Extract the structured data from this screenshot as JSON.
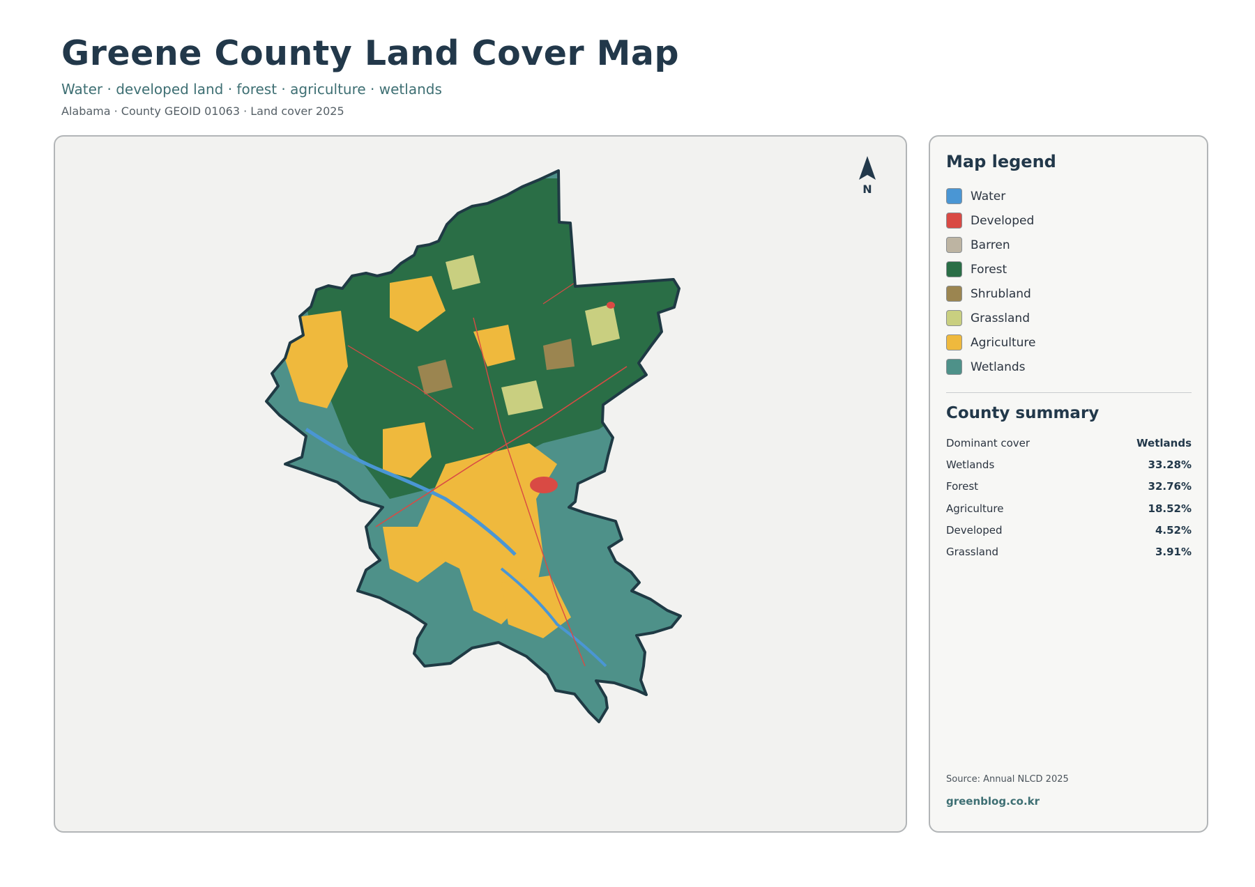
{
  "header": {
    "title": "Greene County Land Cover Map",
    "subtitle": "Water · developed land · forest · agriculture · wetlands",
    "meta": "Alabama · County GEOID 01063 · Land cover 2025"
  },
  "compass": {
    "label": "N"
  },
  "legend": {
    "title": "Map legend",
    "items": [
      {
        "label": "Water",
        "color": "#4a96d4"
      },
      {
        "label": "Developed",
        "color": "#d94a44"
      },
      {
        "label": "Barren",
        "color": "#bdb4a2"
      },
      {
        "label": "Forest",
        "color": "#2a6e46"
      },
      {
        "label": "Shrubland",
        "color": "#9b8550"
      },
      {
        "label": "Grassland",
        "color": "#c9cf80"
      },
      {
        "label": "Agriculture",
        "color": "#efb93d"
      },
      {
        "label": "Wetlands",
        "color": "#4e9189"
      }
    ]
  },
  "summary": {
    "title": "County summary",
    "rows": [
      {
        "key": "Dominant cover",
        "value": "Wetlands"
      },
      {
        "key": "Wetlands",
        "value": "33.28%"
      },
      {
        "key": "Forest",
        "value": "32.76%"
      },
      {
        "key": "Agriculture",
        "value": "18.52%"
      },
      {
        "key": "Developed",
        "value": "4.52%"
      },
      {
        "key": "Grassland",
        "value": "3.91%"
      }
    ]
  },
  "footer": {
    "source": "Source: Annual NLCD 2025",
    "site": "greenblog.co.kr"
  }
}
